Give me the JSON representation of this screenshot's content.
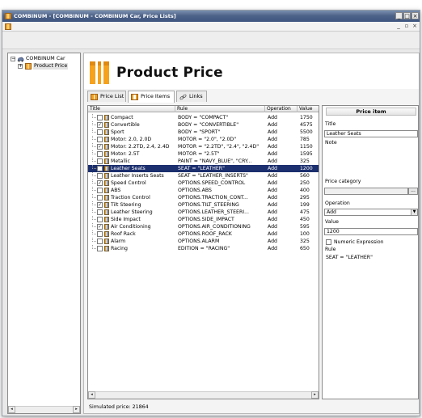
{
  "window": {
    "title": "COMBINUM - [COMBINUM - COMBINUM Car, Price Lists]",
    "controls": [
      "_",
      "□",
      "×"
    ],
    "child_controls": [
      "_",
      "▫",
      "×"
    ]
  },
  "tree": {
    "root_label": "COMBINUM Car",
    "child_label": "Product Price",
    "expand_symbol": "+",
    "collapse_symbol": "−"
  },
  "header": {
    "title": "Product Price"
  },
  "tabs": [
    {
      "label": "Price List",
      "icon": "grid-icon",
      "active": false
    },
    {
      "label": "Price Items",
      "icon": "price-items-icon",
      "active": true
    },
    {
      "label": "Links",
      "icon": "link-icon",
      "active": false
    }
  ],
  "grid": {
    "columns": [
      "Title",
      "Rule",
      "Operation",
      "Value"
    ],
    "rows": [
      {
        "checked": false,
        "title": "Compact",
        "rule": "BODY = \"COMPACT\"",
        "operation": "Add",
        "value": "1750"
      },
      {
        "checked": true,
        "title": "Convertible",
        "rule": "BODY = \"CONVERTIBLE\"",
        "operation": "Add",
        "value": "4575"
      },
      {
        "checked": false,
        "title": "Sport",
        "rule": "BODY = \"SPORT\"",
        "operation": "Add",
        "value": "5500"
      },
      {
        "checked": false,
        "title": "Motor: 2.0, 2.0D",
        "rule": "MOTOR = \"2.0\", \"2.0D\"",
        "operation": "Add",
        "value": "785"
      },
      {
        "checked": true,
        "title": "Motor: 2.2TD, 2.4, 2.4D",
        "rule": "MOTOR = \"2.2TD\", \"2.4\", \"2.4D\"",
        "operation": "Add",
        "value": "1150"
      },
      {
        "checked": false,
        "title": "Motor: 2.5T",
        "rule": "MOTOR = \"2.5T\"",
        "operation": "Add",
        "value": "1595"
      },
      {
        "checked": false,
        "title": "Metallic",
        "rule": "PAINT = \"NAVY_BLUE\", \"CRY...",
        "operation": "Add",
        "value": "325"
      },
      {
        "checked": false,
        "title": "Leather Seats",
        "rule": "SEAT = \"LEATHER\"",
        "operation": "Add",
        "value": "1200",
        "selected": true
      },
      {
        "checked": false,
        "title": "Leather Inserts Seats",
        "rule": "SEAT = \"LEATHER_INSERTS\"",
        "operation": "Add",
        "value": "560"
      },
      {
        "checked": true,
        "title": "Speed Control",
        "rule": "OPTIONS.SPEED_CONTROL",
        "operation": "Add",
        "value": "250"
      },
      {
        "checked": false,
        "title": "ABS",
        "rule": "OPTIONS.ABS",
        "operation": "Add",
        "value": "400"
      },
      {
        "checked": false,
        "title": "Traction Control",
        "rule": "OPTIONS.TRACTION_CONT...",
        "operation": "Add",
        "value": "295"
      },
      {
        "checked": true,
        "title": "Tilt Steering",
        "rule": "OPTIONS.TILT_STEERING",
        "operation": "Add",
        "value": "199"
      },
      {
        "checked": false,
        "title": "Leather Steering",
        "rule": "OPTIONS.LEATHER_STEERI...",
        "operation": "Add",
        "value": "475"
      },
      {
        "checked": false,
        "title": "Side Impact",
        "rule": "OPTIONS.SIDE_IMPACT",
        "operation": "Add",
        "value": "450"
      },
      {
        "checked": true,
        "title": "Air Conditioning",
        "rule": "OPTIONS.AIR_CONDITIONING",
        "operation": "Add",
        "value": "595"
      },
      {
        "checked": false,
        "title": "Roof Rack",
        "rule": "OPTIONS.ROOF_RACK",
        "operation": "Add",
        "value": "100"
      },
      {
        "checked": false,
        "title": "Alarm",
        "rule": "OPTIONS.ALARM",
        "operation": "Add",
        "value": "325"
      },
      {
        "checked": false,
        "title": "Racing",
        "rule": "EDITION = \"RACING\"",
        "operation": "Add",
        "value": "650"
      }
    ],
    "check_mark": "✓",
    "scroll_left": "◂",
    "scroll_right": "▸"
  },
  "status": {
    "label": "Simulated price:",
    "value": "21864"
  },
  "panel": {
    "header": "Price item",
    "title_label": "Title",
    "title_value": "Leather Seats",
    "note_label": "Note",
    "note_value": "",
    "category_label": "Price category",
    "category_value": "",
    "category_button": "...",
    "operation_label": "Operation",
    "operation_value": "Add",
    "value_label": "Value",
    "value_value": "1200",
    "numeric_label": "Numeric Expression",
    "numeric_checked": false,
    "rule_label": "Rule",
    "rule_value": "SEAT = \"LEATHER\""
  },
  "colors": {
    "selection": "#1c2f6e",
    "titlebar": "#4e6389",
    "accent_orange": "#f0a020"
  }
}
